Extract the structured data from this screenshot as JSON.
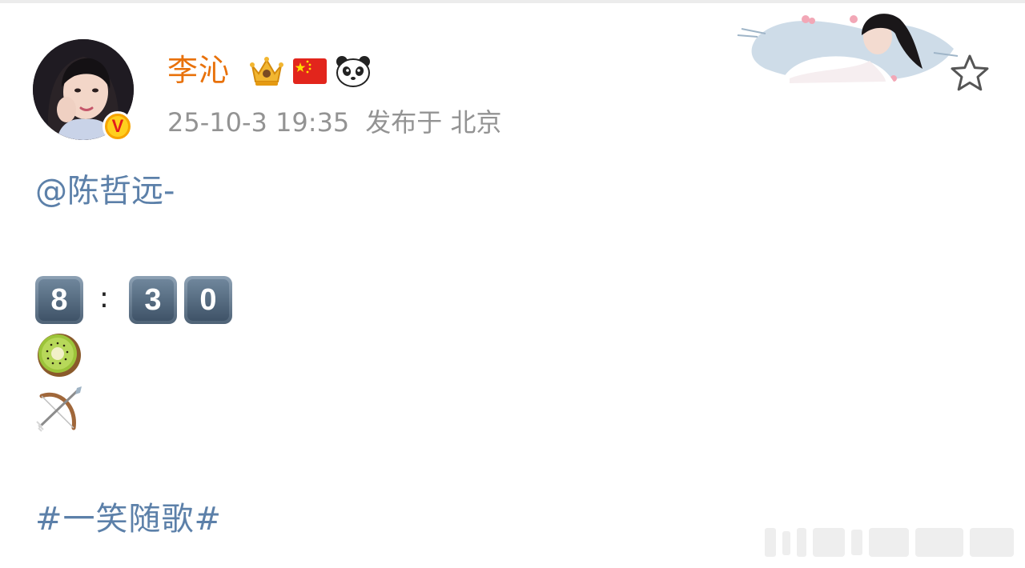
{
  "post": {
    "author": "李沁",
    "date": "25-10-3 19:35",
    "location": "发布于 北京",
    "mention": "@陈哲远-",
    "time_keys": [
      "8",
      "3",
      "0"
    ],
    "time_separator": ":",
    "emojis": [
      "kiwi-emoji",
      "bow-and-arrow-emoji"
    ],
    "hashtag": "#一笑随歌#"
  },
  "icons": {
    "verified": "v-badge",
    "crown": "crown-icon",
    "flag": "china-flag-icon",
    "panda": "panda-icon",
    "favorite": "star-icon"
  },
  "colors": {
    "author": "#e8710a",
    "link": "#5c80a9",
    "meta": "#939393",
    "verified": "#f7a400"
  },
  "badge_letter": "V"
}
